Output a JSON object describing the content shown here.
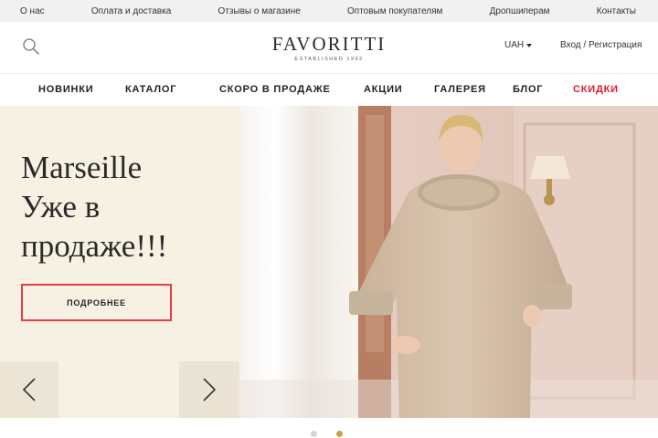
{
  "topbar": {
    "links": [
      "О нас",
      "Оплата и доставка",
      "Отзывы о магазине",
      "Оптовым покупателям",
      "Дропшиперам",
      "Контакты"
    ]
  },
  "header": {
    "search_icon": "search-icon",
    "logo": {
      "name": "FAVORITTI",
      "tagline": "ESTABLISHED 1992"
    },
    "currency": "UAH",
    "auth": "Вход / Регистрация"
  },
  "nav": {
    "items": [
      "НОВИНКИ",
      "КАТАЛОГ",
      "СКОРО В ПРОДАЖЕ",
      "АКЦИИ",
      "ГАЛЕРЕЯ",
      "БЛОГ",
      "СКИДКИ"
    ],
    "sale_color": "#e0182d"
  },
  "hero": {
    "title_line1": "Marseille",
    "title_line2": "Уже в",
    "title_line3": "продаже!!!",
    "button_label": "ПОДРОБНЕЕ",
    "button_border_color": "#e33c47",
    "prev_icon": "chevron-left-icon",
    "next_icon": "chevron-right-icon",
    "background_color": "#f7f1e3"
  },
  "slider": {
    "total": 2,
    "active": 2,
    "active_color": "#c9a24a",
    "inactive_color": "#d6d6d6"
  }
}
